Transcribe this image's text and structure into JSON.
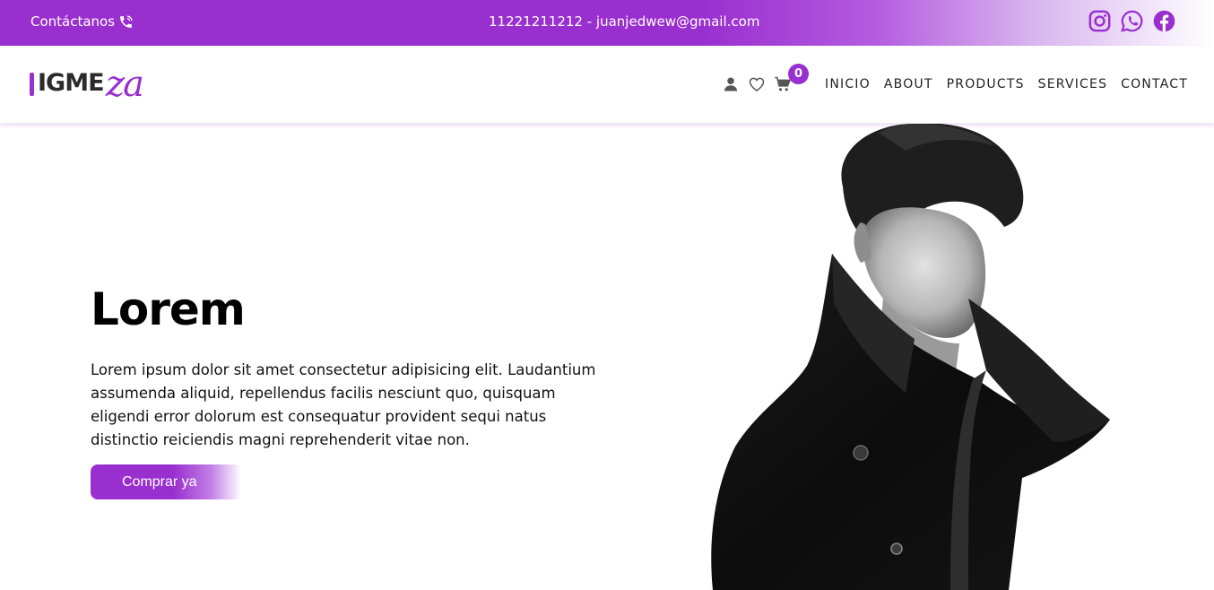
{
  "topbar": {
    "contact_label": "Contáctanos",
    "contact_info": "11221211212 - juanjedwew@gmail.com",
    "socials": [
      "instagram-icon",
      "whatsapp-icon",
      "facebook-icon"
    ]
  },
  "brand": {
    "logo_prefix": "IGME",
    "logo_script": "za"
  },
  "nav": {
    "icons": [
      "user-icon",
      "heart-icon",
      "cart-icon"
    ],
    "cart_count": "0",
    "items": [
      "INICIO",
      "ABOUT",
      "PRODUCTS",
      "SERVICES",
      "CONTACT"
    ]
  },
  "hero": {
    "title": "Lorem",
    "text": "Lorem ipsum dolor sit amet consectetur adipisicing elit. Laudantium assumenda aliquid, repellendus facilis nesciunt quo, quisquam eligendi error dolorum est consequatur provident sequi natus distinctio reiciendis magni reprehenderit vitae non.",
    "button_label": "Comprar ya",
    "image": "man-in-black-coat-photo"
  },
  "colors": {
    "accent": "#9a2fcf"
  }
}
